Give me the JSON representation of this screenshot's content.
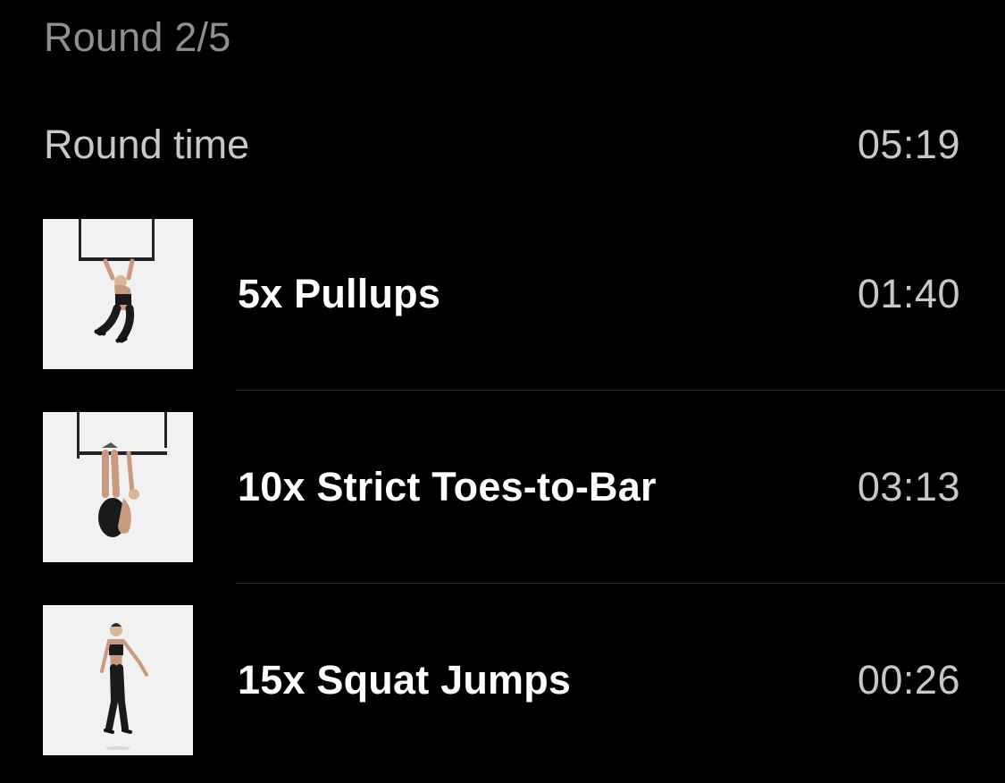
{
  "round": {
    "label": "Round 2/5"
  },
  "round_time": {
    "label": "Round time",
    "value": "05:19"
  },
  "exercises": [
    {
      "name": "5x Pullups",
      "time": "01:40",
      "thumbnail": "pullup-image"
    },
    {
      "name": "10x Strict Toes-to-Bar",
      "time": "03:13",
      "thumbnail": "toes-to-bar-image"
    },
    {
      "name": "15x Squat Jumps",
      "time": "00:26",
      "thumbnail": "squat-jump-image"
    }
  ],
  "colors": {
    "background": "#000000",
    "secondary_text": "#8e8e93",
    "time_text": "#c7c7cc",
    "primary_text": "#ffffff",
    "divider": "#2c2c2e"
  }
}
